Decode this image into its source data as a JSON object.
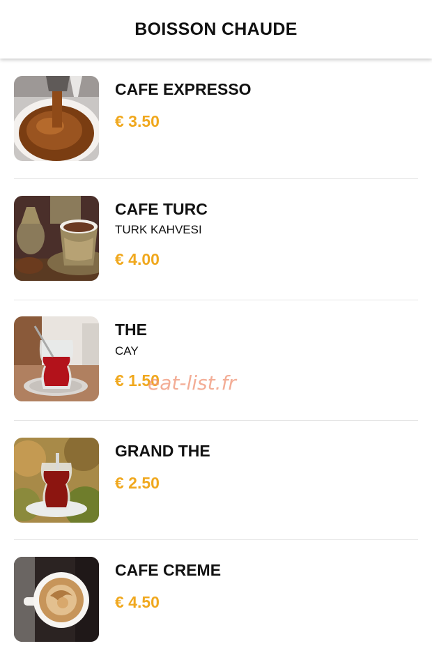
{
  "header": {
    "title": "BOISSON CHAUDE"
  },
  "accent_color": "#F0A81E",
  "items": [
    {
      "name": "CAFE EXPRESSO",
      "subtitle": "",
      "price": "€ 3.50",
      "image": "espresso-cup-photo"
    },
    {
      "name": "CAFE TURC",
      "subtitle": "TURK KAHVESI",
      "price": "€ 4.00",
      "image": "turkish-coffee-set-photo"
    },
    {
      "name": "THE",
      "subtitle": "CAY",
      "price": "€ 1.50",
      "image": "turkish-tea-glass-photo"
    },
    {
      "name": "GRAND THE",
      "subtitle": "",
      "price": "€ 2.50",
      "image": "large-tea-glass-photo"
    },
    {
      "name": "CAFE CREME",
      "subtitle": "",
      "price": "€ 4.50",
      "image": "cafe-creme-cup-photo"
    }
  ],
  "watermark": "eat-list.fr"
}
